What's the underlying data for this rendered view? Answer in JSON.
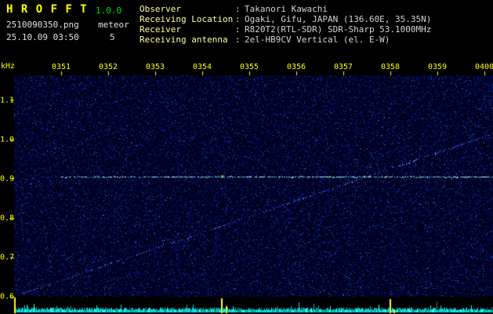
{
  "header": {
    "app_title": "H R O F F T",
    "version": "1.0.0",
    "filename": "2510090350.png",
    "mode": "meteor",
    "datetime": "25.10.09 03:50",
    "count": "5",
    "separator": ":",
    "info": [
      {
        "label": "Observer",
        "value": "Takanori Kawachi"
      },
      {
        "label": "Receiving Location",
        "value": "Ogaki, Gifu, JAPAN (136.60E, 35.35N)"
      },
      {
        "label": "Receiver",
        "value": "R820T2(RTL-SDR) SDR-Sharp 53.1000MHz"
      },
      {
        "label": "Receiving antenna",
        "value": "2el-HB9CV Vertical (el. E-W)"
      }
    ]
  },
  "chart_data": {
    "type": "heatmap",
    "subtype": "radio-meteor-spectrogram",
    "x_axis": {
      "tick_labels": [
        "0351",
        "0352",
        "0353",
        "0354",
        "0355",
        "0356",
        "0357",
        "0358",
        "0359",
        "0400"
      ],
      "start_time": "0350",
      "end_time": "0400",
      "span_minutes": 10
    },
    "y_axis": {
      "unit_label": "kHz",
      "tick_labels": [
        "1.1",
        "1.0",
        "0.9",
        "0.8",
        "0.7",
        "0.6"
      ],
      "tick_values": [
        1.1,
        1.0,
        0.9,
        0.8,
        0.7,
        0.6
      ],
      "min_khz": 0.6,
      "max_khz": 1.16
    },
    "style": {
      "plot_background": "#00001e",
      "axis_color": "#ffff00"
    },
    "signals": [
      {
        "name": "direct-carrier-line",
        "kind": "horizontal",
        "freq_khz": 0.905,
        "start_min": 1.0,
        "end_min": 10.2,
        "palette": [
          "#8dfcf4",
          "#ffffff",
          "#5cd8d8",
          "#a8ffff",
          "#49c8e0"
        ]
      },
      {
        "name": "drifting-carrier-line",
        "kind": "drift",
        "start": {
          "min": 0.05,
          "khz": 0.603
        },
        "end": {
          "min": 10.2,
          "khz": 1.015
        },
        "bright_after_min": 7.0,
        "palette": [
          "#2d4fd8",
          "#3c63f2",
          "#1f3db0",
          "#5578ff",
          "#4466e6"
        ],
        "bright_palette": [
          "#4f7df2",
          "#63a0ff",
          "#3c63f2",
          "#6fb4ff"
        ]
      },
      {
        "name": "meteor-echo-point",
        "kind": "point",
        "min": 4.42,
        "khz": 0.906,
        "color": "#3dff3d"
      }
    ],
    "amplitude_strip": {
      "trace_palette": [
        "#00b8b8",
        "#00d8d8",
        "#00f0f0",
        "#25ffff",
        "#009898"
      ],
      "spike_color": "#ffff29",
      "spikes": [
        {
          "min": 4.42,
          "height": 0.95
        },
        {
          "min": 4.53,
          "height": 0.42
        },
        {
          "min": 8.0,
          "height": 0.9
        },
        {
          "min": 8.09,
          "height": 0.22
        }
      ]
    }
  }
}
